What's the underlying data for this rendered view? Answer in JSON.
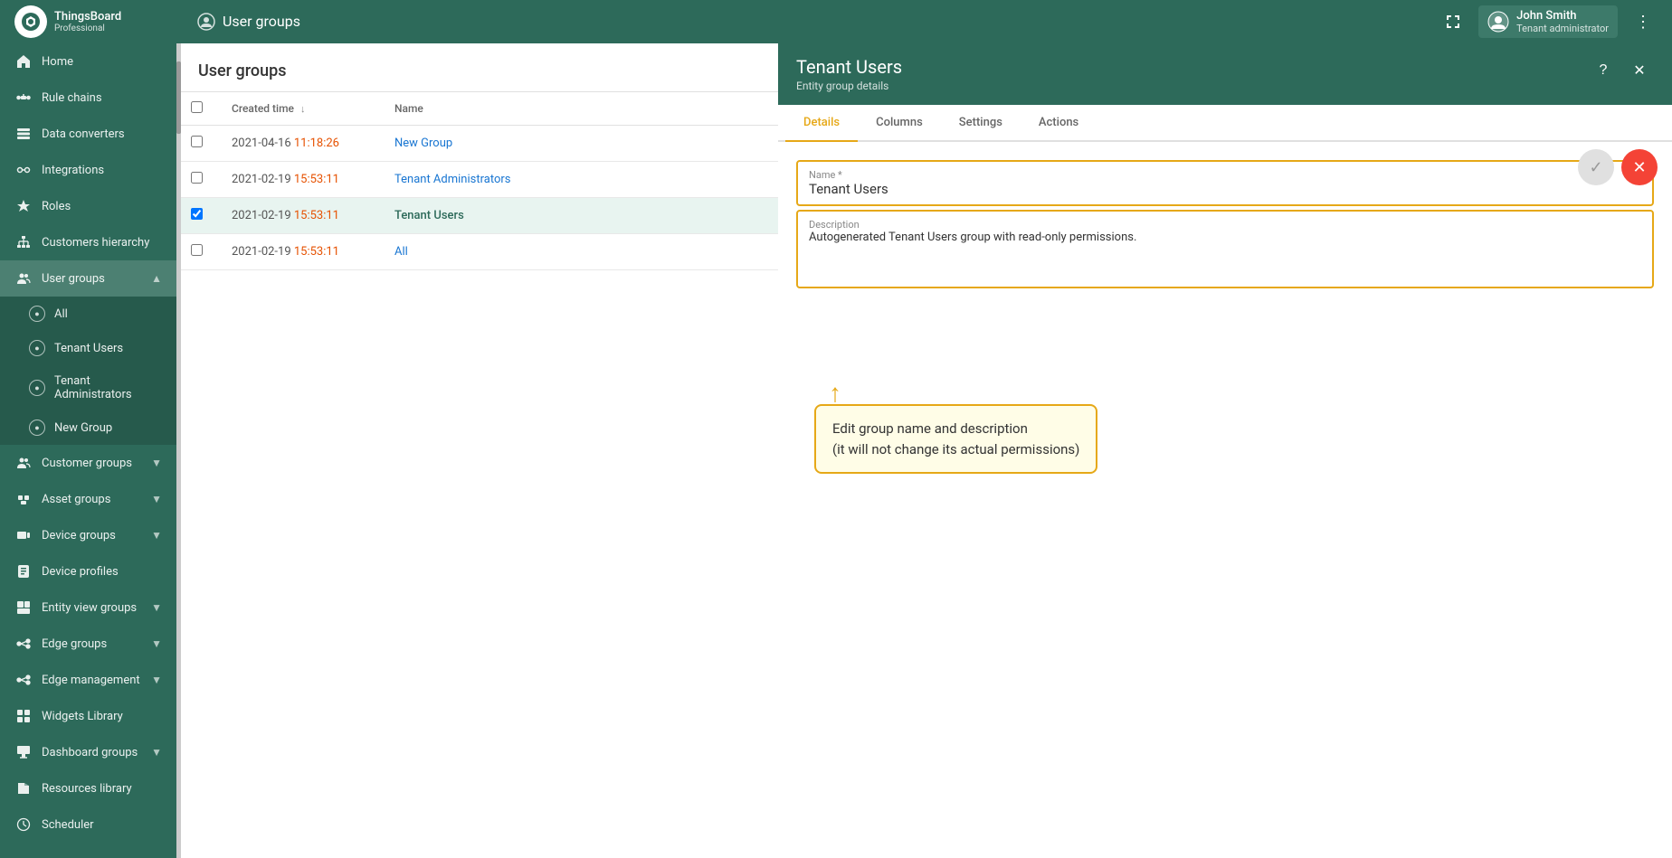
{
  "app": {
    "title": "ThingsBoard",
    "subtitle": "Professional"
  },
  "header": {
    "page_title": "User groups",
    "user_name": "John Smith",
    "user_role": "Tenant administrator",
    "expand_icon": "⤢",
    "menu_icon": "⋮"
  },
  "sidebar": {
    "items": [
      {
        "id": "home",
        "label": "Home",
        "icon": "home"
      },
      {
        "id": "rule-chains",
        "label": "Rule chains",
        "icon": "rule-chains"
      },
      {
        "id": "data-converters",
        "label": "Data converters",
        "icon": "data-converters"
      },
      {
        "id": "integrations",
        "label": "Integrations",
        "icon": "integrations"
      },
      {
        "id": "roles",
        "label": "Roles",
        "icon": "roles"
      },
      {
        "id": "customers-hierarchy",
        "label": "Customers hierarchy",
        "icon": "customers-hierarchy"
      },
      {
        "id": "user-groups",
        "label": "User groups",
        "icon": "user-groups",
        "active": true,
        "expanded": true
      },
      {
        "id": "customer-groups",
        "label": "Customer groups",
        "icon": "customer-groups",
        "chevron": true
      },
      {
        "id": "asset-groups",
        "label": "Asset groups",
        "icon": "asset-groups",
        "chevron": true
      },
      {
        "id": "device-groups",
        "label": "Device groups",
        "icon": "device-groups",
        "chevron": true
      },
      {
        "id": "device-profiles",
        "label": "Device profiles",
        "icon": "device-profiles"
      },
      {
        "id": "entity-view-groups",
        "label": "Entity view groups",
        "icon": "entity-view-groups",
        "chevron": true
      },
      {
        "id": "edge-groups",
        "label": "Edge groups",
        "icon": "edge-groups",
        "chevron": true
      },
      {
        "id": "edge-management",
        "label": "Edge management",
        "icon": "edge-management",
        "chevron": true
      },
      {
        "id": "widgets-library",
        "label": "Widgets Library",
        "icon": "widgets-library"
      },
      {
        "id": "dashboard-groups",
        "label": "Dashboard groups",
        "icon": "dashboard-groups",
        "chevron": true
      },
      {
        "id": "resources-library",
        "label": "Resources library",
        "icon": "resources-library"
      },
      {
        "id": "scheduler",
        "label": "Scheduler",
        "icon": "scheduler"
      }
    ],
    "sub_items": [
      {
        "id": "all",
        "label": "All",
        "icon": "user-circle"
      },
      {
        "id": "tenant-users",
        "label": "Tenant Users",
        "icon": "user-circle"
      },
      {
        "id": "tenant-administrators",
        "label": "Tenant Administrators",
        "icon": "user-circle"
      },
      {
        "id": "new-group",
        "label": "New Group",
        "icon": "user-circle"
      }
    ]
  },
  "table": {
    "title": "User groups",
    "columns": [
      {
        "id": "checkbox",
        "label": ""
      },
      {
        "id": "created_time",
        "label": "Created time",
        "sort": "desc"
      },
      {
        "id": "name",
        "label": "Name"
      }
    ],
    "rows": [
      {
        "id": 1,
        "created": "2021-04-16 11:18:26",
        "created_highlight": "11:18:26",
        "name": "New Group",
        "selected": false
      },
      {
        "id": 2,
        "created": "2021-02-19 15:53:11",
        "created_highlight": "15:53:11",
        "name": "Tenant Administrators",
        "selected": false
      },
      {
        "id": 3,
        "created": "2021-02-19 15:53:11",
        "created_highlight": "15:53:11",
        "name": "Tenant Users",
        "selected": true
      },
      {
        "id": 4,
        "created": "2021-02-19 15:53:11",
        "created_highlight": "15:53:11",
        "name": "All",
        "selected": false
      }
    ]
  },
  "details": {
    "title": "Tenant Users",
    "subtitle": "Entity group details",
    "tabs": [
      {
        "id": "details",
        "label": "Details",
        "active": true
      },
      {
        "id": "columns",
        "label": "Columns",
        "active": false
      },
      {
        "id": "settings",
        "label": "Settings",
        "active": false
      },
      {
        "id": "actions",
        "label": "Actions",
        "active": false
      }
    ],
    "form": {
      "name_label": "Name *",
      "name_value": "Tenant Users",
      "description_label": "Description",
      "description_value": "Autogenerated Tenant Users group with read-only permissions."
    },
    "callout": {
      "line1": "Edit group name and description",
      "line2": "(it will not change its actual permissions)"
    },
    "buttons": {
      "confirm": "✓",
      "close": "✕"
    }
  }
}
